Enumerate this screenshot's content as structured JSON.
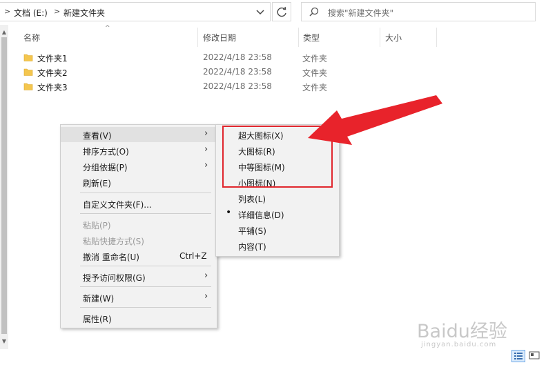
{
  "address_bar": {
    "breadcrumbs": [
      "文档 (E:)",
      "新建文件夹"
    ],
    "search_placeholder": "搜索\"新建文件夹\""
  },
  "columns": [
    "名称",
    "修改日期",
    "类型",
    "大小"
  ],
  "files": [
    {
      "name": "文件夹1",
      "modified": "2022/4/18 23:58",
      "type": "文件夹"
    },
    {
      "name": "文件夹2",
      "modified": "2022/4/18 23:58",
      "type": "文件夹"
    },
    {
      "name": "文件夹3",
      "modified": "2022/4/18 23:58",
      "type": "文件夹"
    }
  ],
  "context_menu": {
    "items": [
      {
        "label": "查看(V)",
        "has_submenu": true
      },
      {
        "label": "排序方式(O)",
        "has_submenu": true
      },
      {
        "label": "分组依据(P)",
        "has_submenu": true
      },
      {
        "label": "刷新(E)"
      },
      {
        "label": "自定义文件夹(F)..."
      },
      {
        "label": "粘贴(P)",
        "disabled": true
      },
      {
        "label": "粘贴快捷方式(S)",
        "disabled": true
      },
      {
        "label": "撤消 重命名(U)",
        "shortcut": "Ctrl+Z"
      },
      {
        "label": "授予访问权限(G)",
        "has_submenu": true
      },
      {
        "label": "新建(W)",
        "has_submenu": true
      },
      {
        "label": "属性(R)"
      }
    ]
  },
  "view_submenu": {
    "items": [
      {
        "label": "超大图标(X)"
      },
      {
        "label": "大图标(R)"
      },
      {
        "label": "中等图标(M)"
      },
      {
        "label": "小图标(N)"
      },
      {
        "label": "列表(L)"
      },
      {
        "label": "详细信息(D)",
        "selected": true
      },
      {
        "label": "平铺(S)"
      },
      {
        "label": "内容(T)"
      }
    ]
  },
  "watermark": {
    "brand": "Baidu经验",
    "url": "jingyan.baidu.com"
  },
  "colors": {
    "highlight_box": "#e0262d",
    "arrow": "#e8232b",
    "folder": "#f4c64e"
  }
}
